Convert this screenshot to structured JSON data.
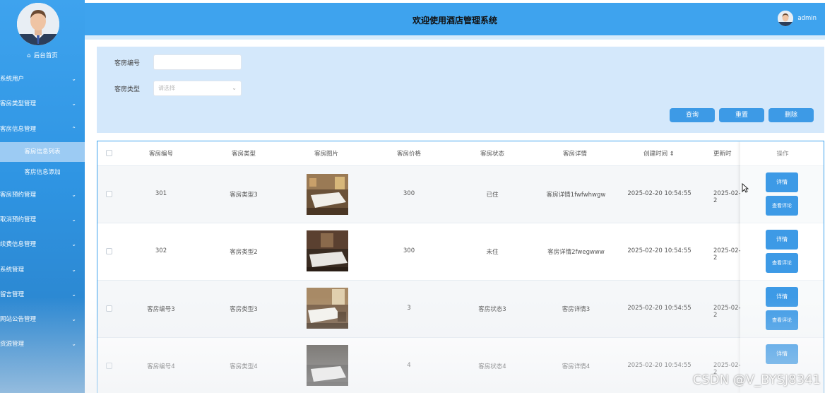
{
  "header": {
    "title": "欢迎使用酒店管理系统",
    "username": "admin"
  },
  "sidebar": {
    "home": "后台首页",
    "items": [
      {
        "label": "系统用户"
      },
      {
        "label": "客房类型管理"
      },
      {
        "label": "客房信息管理",
        "expanded": true
      },
      {
        "label": "客房预约管理"
      },
      {
        "label": "取消预约管理"
      },
      {
        "label": "续费信息管理"
      },
      {
        "label": "系统管理"
      },
      {
        "label": "留言管理"
      },
      {
        "label": "网站公告管理"
      },
      {
        "label": "资源管理"
      }
    ],
    "sub_items": [
      {
        "label": "客房信息列表",
        "active": true
      },
      {
        "label": "客房信息添加"
      }
    ]
  },
  "search": {
    "room_no_label": "客房编号",
    "room_no_value": "",
    "room_type_label": "客房类型",
    "room_type_placeholder": "请选择",
    "buttons": {
      "query": "查询",
      "reset": "重置",
      "delete": "删除"
    }
  },
  "table": {
    "columns": [
      "客房编号",
      "客房类型",
      "客房图片",
      "客房价格",
      "客房状态",
      "客房详情",
      "创建时间",
      "更新时",
      "操作"
    ],
    "rows": [
      {
        "no": "301",
        "type": "客房类型3",
        "price": "300",
        "status": "已住",
        "detail": "客房详情1fwfwhwgw",
        "created": "2025-02-20 10:54:55",
        "updated": "2025-02-2"
      },
      {
        "no": "302",
        "type": "客房类型2",
        "price": "300",
        "status": "未住",
        "detail": "客房详情2fwegwww",
        "created": "2025-02-20 10:54:55",
        "updated": "2025-02-2"
      },
      {
        "no": "客房编号3",
        "type": "客房类型3",
        "price": "3",
        "status": "客房状态3",
        "detail": "客房详情3",
        "created": "2025-02-20 10:54:55",
        "updated": "2025-02-2"
      },
      {
        "no": "客房编号4",
        "type": "客房类型4",
        "price": "4",
        "status": "客房状态4",
        "detail": "客房详情4",
        "created": "2025-02-20 10:54:55",
        "updated": "2025-02-2"
      }
    ],
    "actions": {
      "detail": "详情",
      "reviews": "查看评论"
    }
  },
  "watermark": "CSDN @V_BYSJ8341",
  "colors": {
    "primary": "#3ea3ee",
    "button": "#3d9ae6",
    "panel": "#d4e8fb"
  }
}
